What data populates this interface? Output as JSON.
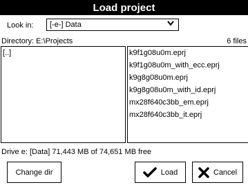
{
  "dialog": {
    "title": "Load project"
  },
  "lookin": {
    "label": "Look in:",
    "value": "[-e-]  Data"
  },
  "directory": {
    "label": "Directory: E:\\Projects",
    "count": "6 files"
  },
  "folders": [
    "[..]"
  ],
  "files": [
    "k9f1g08u0m.eprj",
    "k9f1g08u0m_with_ecc.eprj",
    "k9g8g08u0m.eprj",
    "k9g8g08u0m_with_id.eprj",
    "mx28f640c3bb_em.eprj",
    "mx28f640c3bb_it.eprj"
  ],
  "drive": {
    "info": "Drive e: [Data]  71,443 MB of 74,651 MB free"
  },
  "buttons": {
    "change_dir": "Change dir",
    "load": "Load",
    "cancel": "Cancel"
  }
}
